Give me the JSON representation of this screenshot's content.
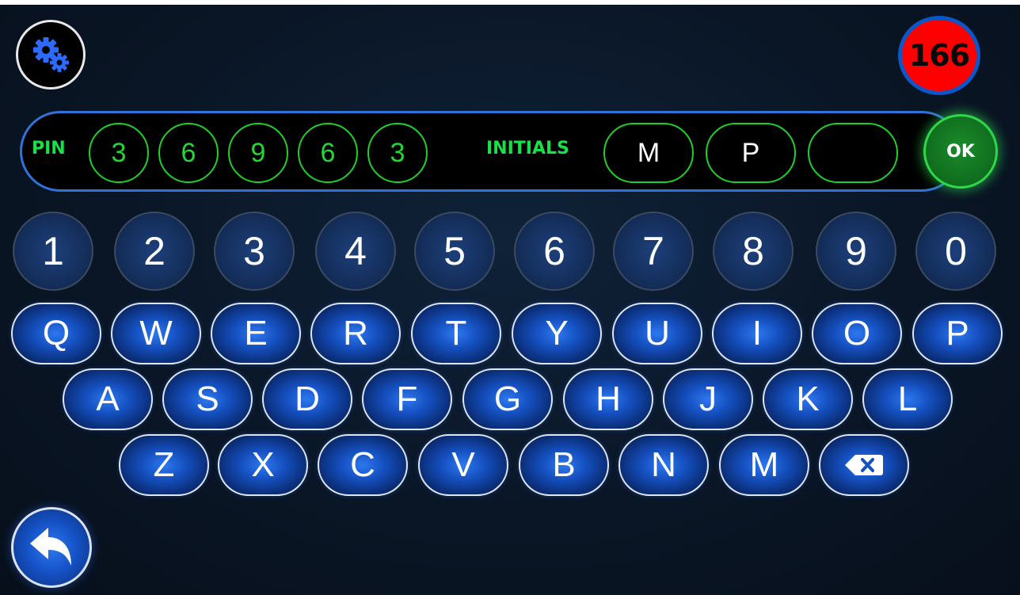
{
  "header": {
    "settings_icon": "gears-icon",
    "counter_value": "166",
    "counter_color": "#ff0000",
    "counter_ring_color": "#0b57c9"
  },
  "entry": {
    "pin_label": "PIN",
    "pin_digits": [
      "3",
      "6",
      "9",
      "6",
      "3"
    ],
    "initials_label": "INITIALS",
    "initials": [
      "M",
      "P",
      ""
    ],
    "ok_label": "OK",
    "accent_color": "#17e24a",
    "bar_border_color": "#2f73d9"
  },
  "keyboard": {
    "numbers": [
      "1",
      "2",
      "3",
      "4",
      "5",
      "6",
      "7",
      "8",
      "9",
      "0"
    ],
    "row1": [
      "Q",
      "W",
      "E",
      "R",
      "T",
      "Y",
      "U",
      "I",
      "O",
      "P"
    ],
    "row2": [
      "A",
      "S",
      "D",
      "F",
      "G",
      "H",
      "J",
      "K",
      "L"
    ],
    "row3": [
      "Z",
      "X",
      "C",
      "V",
      "B",
      "N",
      "M"
    ],
    "backspace_icon": "backspace-icon"
  },
  "footer": {
    "back_icon": "back-arrow-icon"
  }
}
